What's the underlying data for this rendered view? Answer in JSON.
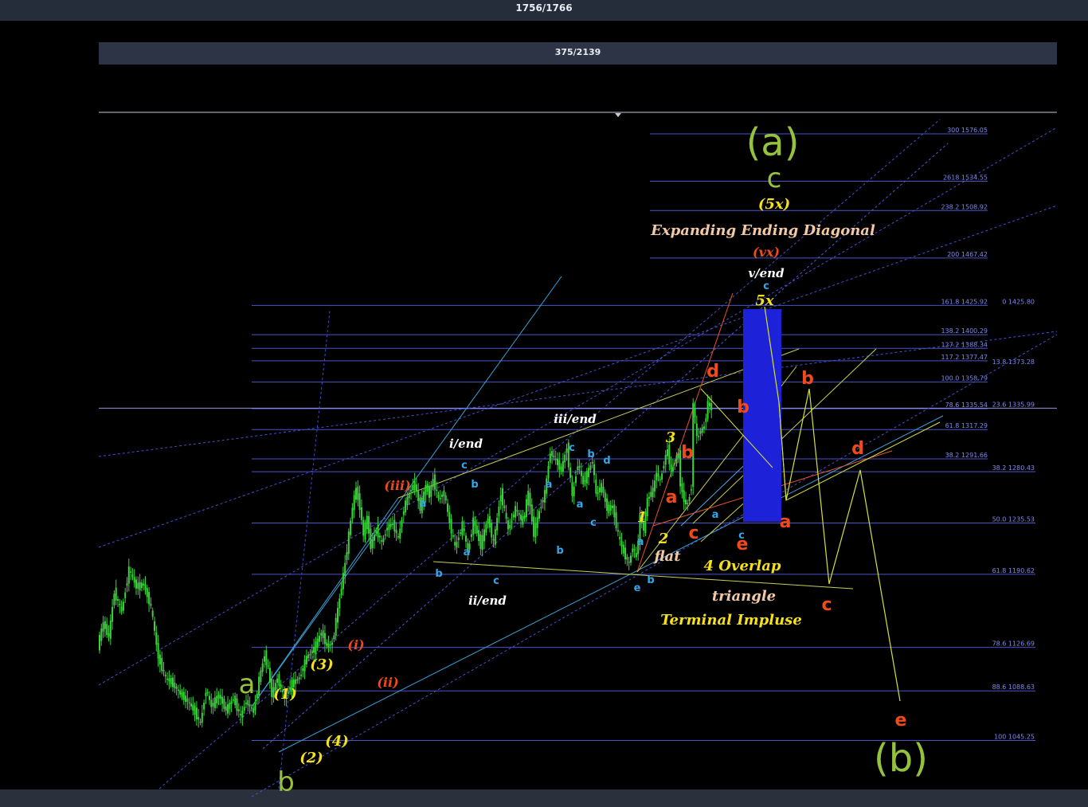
{
  "header": {
    "counter": "1756/1766"
  },
  "subheader": {
    "counter": "375/2139"
  },
  "chart_data": {
    "type": "candlestick",
    "title": "",
    "xlabel": "",
    "ylabel": "",
    "ylim": [
      1030,
      1600
    ],
    "grid": false,
    "fib_levels": [
      {
        "label": "300 1576.05",
        "value": 1576.05
      },
      {
        "label": "2618 1534.55",
        "value": 1534.55
      },
      {
        "label": "238.2 1508.92",
        "value": 1508.92
      },
      {
        "label": "200 1467.42",
        "value": 1467.42
      },
      {
        "label": "161.8 1425.92",
        "value": 1425.92
      },
      {
        "label": "138.2 1400.29",
        "value": 1400.29
      },
      {
        "label": "127.2 1388.34",
        "value": 1388.34
      },
      {
        "label": "117.2 1377.47",
        "value": 1377.47
      },
      {
        "label": "100.0 1358.79",
        "value": 1358.79
      },
      {
        "label": "78.6 1335.54",
        "value": 1335.54
      },
      {
        "label": "61.8 1317.29",
        "value": 1317.29
      },
      {
        "label": "38.2 1291.66",
        "value": 1291.66
      }
    ],
    "retrace_levels": [
      {
        "label": "0 1425.80",
        "value": 1425.8
      },
      {
        "label": "13.8 1373.28",
        "value": 1373.28
      },
      {
        "label": "23.6 1335.99",
        "value": 1335.99
      },
      {
        "label": "38.2 1280.43",
        "value": 1280.43
      },
      {
        "label": "50.0 1235.53",
        "value": 1235.53
      },
      {
        "label": "61.8 1190.62",
        "value": 1190.62
      },
      {
        "label": "78.6 1126.69",
        "value": 1126.69
      },
      {
        "label": "88.6 1088.63",
        "value": 1088.63
      },
      {
        "label": "100 1045.25",
        "value": 1045.25
      }
    ],
    "price_path": [
      [
        0,
        1128
      ],
      [
        6,
        1148
      ],
      [
        12,
        1136
      ],
      [
        18,
        1175
      ],
      [
        26,
        1158
      ],
      [
        34,
        1195
      ],
      [
        42,
        1180
      ],
      [
        50,
        1182
      ],
      [
        58,
        1162
      ],
      [
        66,
        1118
      ],
      [
        74,
        1100
      ],
      [
        82,
        1095
      ],
      [
        90,
        1086
      ],
      [
        98,
        1080
      ],
      [
        106,
        1070
      ],
      [
        112,
        1060
      ],
      [
        118,
        1090
      ],
      [
        124,
        1075
      ],
      [
        132,
        1085
      ],
      [
        140,
        1072
      ],
      [
        148,
        1082
      ],
      [
        156,
        1066
      ],
      [
        162,
        1080
      ],
      [
        170,
        1070
      ],
      [
        176,
        1098
      ],
      [
        182,
        1120
      ],
      [
        186,
        1108
      ],
      [
        190,
        1085
      ],
      [
        196,
        1100
      ],
      [
        204,
        1082
      ],
      [
        212,
        1095
      ],
      [
        220,
        1100
      ],
      [
        228,
        1118
      ],
      [
        236,
        1125
      ],
      [
        244,
        1140
      ],
      [
        250,
        1128
      ],
      [
        256,
        1130
      ],
      [
        262,
        1160
      ],
      [
        266,
        1180
      ],
      [
        270,
        1200
      ],
      [
        274,
        1225
      ],
      [
        278,
        1250
      ],
      [
        282,
        1265
      ],
      [
        286,
        1250
      ],
      [
        290,
        1225
      ],
      [
        294,
        1240
      ],
      [
        298,
        1215
      ],
      [
        304,
        1230
      ],
      [
        310,
        1218
      ],
      [
        316,
        1232
      ],
      [
        322,
        1235
      ],
      [
        328,
        1222
      ],
      [
        334,
        1248
      ],
      [
        340,
        1262
      ],
      [
        346,
        1270
      ],
      [
        352,
        1248
      ],
      [
        358,
        1268
      ],
      [
        362,
        1260
      ],
      [
        366,
        1274
      ],
      [
        372,
        1256
      ],
      [
        378,
        1262
      ],
      [
        384,
        1236
      ],
      [
        390,
        1214
      ],
      [
        398,
        1234
      ],
      [
        404,
        1210
      ],
      [
        410,
        1238
      ],
      [
        418,
        1216
      ],
      [
        426,
        1240
      ],
      [
        432,
        1218
      ],
      [
        440,
        1262
      ],
      [
        448,
        1230
      ],
      [
        456,
        1248
      ],
      [
        464,
        1236
      ],
      [
        470,
        1262
      ],
      [
        476,
        1226
      ],
      [
        482,
        1246
      ],
      [
        488,
        1262
      ],
      [
        494,
        1298
      ],
      [
        500,
        1290
      ],
      [
        506,
        1282
      ],
      [
        512,
        1302
      ],
      [
        518,
        1258
      ],
      [
        524,
        1288
      ],
      [
        530,
        1270
      ],
      [
        536,
        1282
      ],
      [
        540,
        1290
      ],
      [
        544,
        1260
      ],
      [
        550,
        1268
      ],
      [
        556,
        1248
      ],
      [
        562,
        1250
      ],
      [
        568,
        1225
      ],
      [
        574,
        1210
      ],
      [
        580,
        1200
      ],
      [
        584,
        1215
      ],
      [
        588,
        1205
      ],
      [
        592,
        1240
      ],
      [
        596,
        1230
      ],
      [
        600,
        1256
      ],
      [
        606,
        1264
      ],
      [
        610,
        1280
      ],
      [
        614,
        1272
      ],
      [
        618,
        1288
      ],
      [
        622,
        1300
      ],
      [
        626,
        1280
      ],
      [
        630,
        1290
      ],
      [
        634,
        1296
      ],
      [
        636,
        1270
      ],
      [
        640,
        1255
      ],
      [
        644,
        1252
      ],
      [
        648,
        1268
      ],
      [
        650,
        1340
      ],
      [
        654,
        1310
      ],
      [
        658,
        1316
      ],
      [
        662,
        1320
      ],
      [
        666,
        1340
      ],
      [
        670,
        1336
      ]
    ],
    "wave_labels": [
      {
        "text": "(a)",
        "group": "green_big"
      },
      {
        "text": "c",
        "group": "green_mid"
      },
      {
        "text": "(5x)",
        "group": "yellow"
      },
      {
        "text": "Expanding Ending Diagonal",
        "group": "tan"
      },
      {
        "text": "(vx)",
        "group": "red_small"
      },
      {
        "text": "v/end",
        "group": "white"
      },
      {
        "text": "c",
        "group": "blue"
      },
      {
        "text": "5x",
        "group": "yellow"
      },
      {
        "text": "d",
        "group": "red"
      },
      {
        "text": "b",
        "group": "red"
      },
      {
        "text": "iii/end",
        "group": "white"
      },
      {
        "text": "i/end",
        "group": "white"
      },
      {
        "text": "c",
        "group": "blue"
      },
      {
        "text": "b",
        "group": "blue"
      },
      {
        "text": "(iii)",
        "group": "red_small"
      },
      {
        "text": "a",
        "group": "blue"
      },
      {
        "text": "a",
        "group": "blue"
      },
      {
        "text": "a",
        "group": "blue"
      },
      {
        "text": "c",
        "group": "blue"
      },
      {
        "text": "b",
        "group": "blue"
      },
      {
        "text": "d",
        "group": "blue"
      },
      {
        "text": "a",
        "group": "blue"
      },
      {
        "text": "c",
        "group": "blue"
      },
      {
        "text": "b",
        "group": "blue"
      },
      {
        "text": "c",
        "group": "blue"
      },
      {
        "text": "b",
        "group": "blue"
      },
      {
        "text": "ii/end",
        "group": "white"
      },
      {
        "text": "3",
        "group": "yellow"
      },
      {
        "text": "b",
        "group": "red"
      },
      {
        "text": "a",
        "group": "red"
      },
      {
        "text": "1",
        "group": "yellow"
      },
      {
        "text": "a",
        "group": "blue"
      },
      {
        "text": "2",
        "group": "yellow"
      },
      {
        "text": "c",
        "group": "red"
      },
      {
        "text": "a",
        "group": "blue"
      },
      {
        "text": "c",
        "group": "blue"
      },
      {
        "text": "e",
        "group": "red"
      },
      {
        "text": "a",
        "group": "red"
      },
      {
        "text": "b",
        "group": "red"
      },
      {
        "text": "d",
        "group": "red"
      },
      {
        "text": "flat",
        "group": "tan"
      },
      {
        "text": "4 Overlap",
        "group": "yellow"
      },
      {
        "text": "triangle",
        "group": "tan"
      },
      {
        "text": "Terminal Impluse",
        "group": "yellow"
      },
      {
        "text": "b",
        "group": "blue"
      },
      {
        "text": "e",
        "group": "blue"
      },
      {
        "text": "c",
        "group": "red"
      },
      {
        "text": "e",
        "group": "red"
      },
      {
        "text": "(b)",
        "group": "green_big"
      },
      {
        "text": "a",
        "group": "green_mid"
      },
      {
        "text": "b",
        "group": "green_mid"
      },
      {
        "text": "(1)",
        "group": "yellow"
      },
      {
        "text": "(3)",
        "group": "yellow"
      },
      {
        "text": "(2)",
        "group": "yellow"
      },
      {
        "text": "(4)",
        "group": "yellow"
      },
      {
        "text": "(i)",
        "group": "red_small"
      },
      {
        "text": "(ii)",
        "group": "red_small"
      }
    ],
    "colors": {
      "candle": "#39d33a",
      "fib_line": "#4a55c8",
      "fib_text": "#7f88ee",
      "blue_box": "#1d22d8",
      "green_label": "#95c23c",
      "yellow_label": "#f5e11a",
      "red_label": "#f0491c",
      "blue_label": "#33a7e8",
      "tan_label": "#f2c9a4",
      "white_label": "#ffffff"
    }
  }
}
